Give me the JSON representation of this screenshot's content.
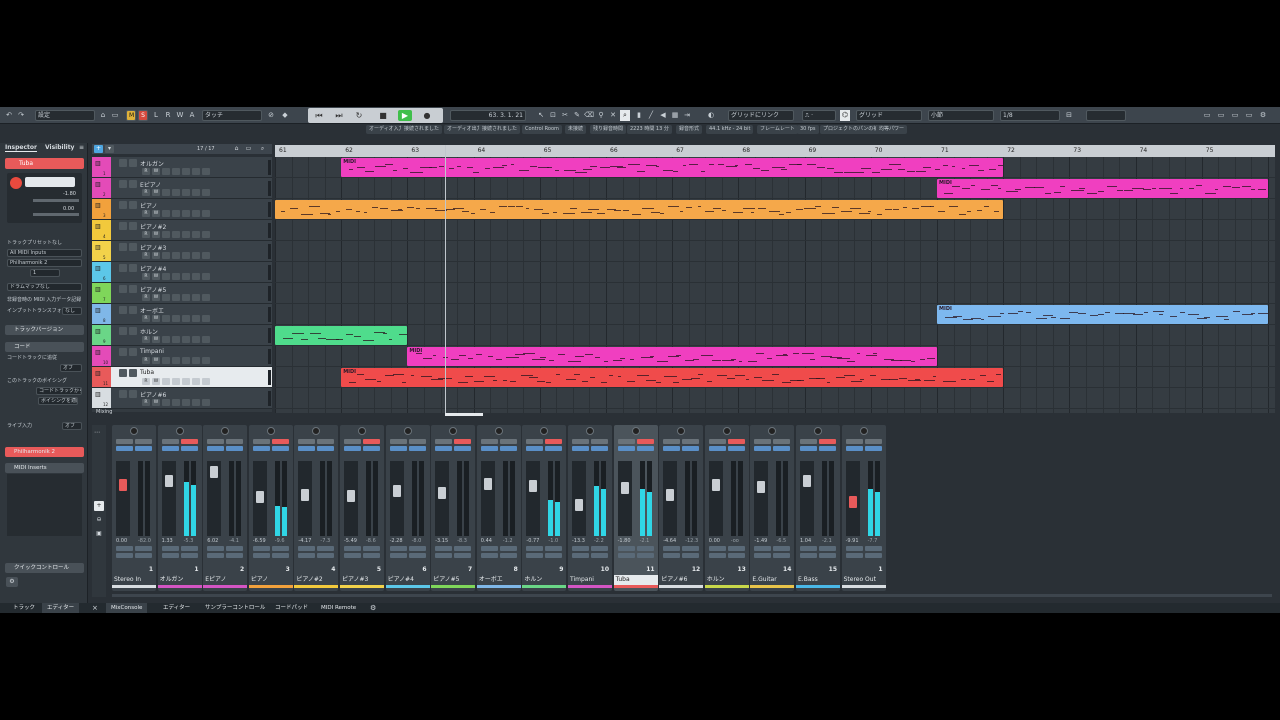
{
  "toolbar": {
    "preset": "設定",
    "mode_buttons": [
      "M",
      "S",
      "L",
      "R",
      "W",
      "A"
    ],
    "touch_mode": "タッチ",
    "position": "63. 3. 1. 21",
    "grid_link": "グリッドにリンク",
    "snap_type": "グリッド",
    "quantize_unit": "小節",
    "quantize_value": "1/8"
  },
  "status": [
    "オーディオ入力",
    "接続されました",
    "オーディオ出力",
    "接続されました",
    "Control Room",
    "未接続",
    "残り録音時間",
    "2223 時間 13 分",
    "録音形式",
    "44.1 kHz - 24 bit",
    "フレームレート",
    "30 fps",
    "プロジェクトのパンの補正",
    "均等パワー"
  ],
  "inspector": {
    "tabs": [
      "Inspector",
      "Visibility"
    ],
    "track_name": "Tuba",
    "volume": "-1.80",
    "value_zero": "0.00",
    "track_preset": "トラックプリセットなし",
    "midi_input": "All MIDI Inputs",
    "midi_output": "Philharmonik 2",
    "channel": "1",
    "drum_map": "ドラムマップなし",
    "mapping": "非録音時の MIDI 入力データ記録",
    "input_transformer": "インプットトランスフォーマー",
    "input_transformer_val": "なし",
    "sections": {
      "versions": "トラックバージョン",
      "chords": "コード",
      "chord_track": "コードトラックに追従",
      "chord_track_val": "オフ",
      "voicing": "このトラックのボイシング",
      "voicing_val": "コードトラックから",
      "voicing_adapt": "ボイシングを適応",
      "live_input": "ライブ入力",
      "live_input_val": "オフ",
      "instrument": "Philharmonik 2",
      "midi_inserts": "MIDI Inserts",
      "quick_controls": "クイックコントロール"
    }
  },
  "tracklist": {
    "count": "17 / 17",
    "footer": "Mixing",
    "buttons": [
      "R",
      "W",
      "",
      "",
      "",
      "",
      ""
    ],
    "tracks": [
      {
        "name": "オルガン",
        "num": "1",
        "color": "#e44bb8"
      },
      {
        "name": "Eピアノ",
        "num": "2",
        "color": "#e44bb8"
      },
      {
        "name": "ピアノ",
        "num": "3",
        "color": "#f2a13c"
      },
      {
        "name": "ピアノ#2",
        "num": "4",
        "color": "#f2c93c"
      },
      {
        "name": "ピアノ#3",
        "num": "5",
        "color": "#f2d24a"
      },
      {
        "name": "ピアノ#4",
        "num": "6",
        "color": "#5cc7e8"
      },
      {
        "name": "ピアノ#5",
        "num": "7",
        "color": "#7fd65a"
      },
      {
        "name": "オーボエ",
        "num": "8",
        "color": "#7fb7e8"
      },
      {
        "name": "ホルン",
        "num": "9",
        "color": "#6ad687"
      },
      {
        "name": "Timpani",
        "num": "10",
        "color": "#e44bb8"
      },
      {
        "name": "Tuba",
        "num": "11",
        "color": "#e85a5a"
      },
      {
        "name": "ピアノ#6",
        "num": "12",
        "color": "#d8dde1"
      }
    ]
  },
  "ruler": {
    "bars": [
      "61",
      "62",
      "63",
      "64",
      "65",
      "66",
      "67",
      "68",
      "69",
      "70",
      "71",
      "72",
      "73",
      "74",
      "75"
    ]
  },
  "arrange": {
    "clips": [
      {
        "lane": 0,
        "start": 62,
        "end": 72,
        "color": "#f03fc0",
        "label": "MIDI"
      },
      {
        "lane": 1,
        "start": 71,
        "end": 76,
        "color": "#f03fc0",
        "label": "MIDI"
      },
      {
        "lane": 2,
        "start": 61,
        "end": 72,
        "color": "#f5a84a",
        "label": ""
      },
      {
        "lane": 7,
        "start": 71,
        "end": 76,
        "color": "#7db8ef",
        "label": "MIDI"
      },
      {
        "lane": 8,
        "start": 61,
        "end": 63,
        "color": "#4fdc8c",
        "label": ""
      },
      {
        "lane": 9,
        "start": 63,
        "end": 71,
        "color": "#f03fc0",
        "label": "MIDI"
      },
      {
        "lane": 10,
        "start": 62,
        "end": 72,
        "color": "#f04b4b",
        "label": "MIDI"
      }
    ]
  },
  "mixer": {
    "channels": [
      {
        "name": "Stereo In",
        "num": "1",
        "vol": "0.00",
        "peak": "-82.0",
        "fader": 0.72,
        "level": 0.0,
        "color": "#d8dde1"
      },
      {
        "name": "オルガン",
        "num": "1",
        "vol": "1.33",
        "peak": "-5.3",
        "fader": 0.78,
        "level": 0.72,
        "color": "#d455c4"
      },
      {
        "name": "Eピアノ",
        "num": "2",
        "vol": "6.02",
        "peak": "-4.1",
        "fader": 0.92,
        "level": 0.0,
        "color": "#d455c4"
      },
      {
        "name": "ピアノ",
        "num": "3",
        "vol": "-6.59",
        "peak": "-9.6",
        "fader": 0.52,
        "level": 0.4,
        "color": "#f2a13c"
      },
      {
        "name": "ピアノ#2",
        "num": "4",
        "vol": "-4.17",
        "peak": "-7.3",
        "fader": 0.56,
        "level": 0.0,
        "color": "#f2c93c"
      },
      {
        "name": "ピアノ#3",
        "num": "5",
        "vol": "-5.49",
        "peak": "-8.6",
        "fader": 0.54,
        "level": 0.0,
        "color": "#f2d24a"
      },
      {
        "name": "ピアノ#4",
        "num": "6",
        "vol": "-2.28",
        "peak": "-8.0",
        "fader": 0.62,
        "level": 0.0,
        "color": "#5cc7e8"
      },
      {
        "name": "ピアノ#5",
        "num": "7",
        "vol": "-3.15",
        "peak": "-8.3",
        "fader": 0.58,
        "level": 0.0,
        "color": "#7fd65a"
      },
      {
        "name": "オーボエ",
        "num": "8",
        "vol": "0.44",
        "peak": "-1.2",
        "fader": 0.73,
        "level": 0.0,
        "color": "#7fb7e8"
      },
      {
        "name": "ホルン",
        "num": "9",
        "vol": "-0.77",
        "peak": "-1.0",
        "fader": 0.7,
        "level": 0.48,
        "color": "#6ad687"
      },
      {
        "name": "Timpani",
        "num": "10",
        "vol": "-13.3",
        "peak": "-2.2",
        "fader": 0.4,
        "level": 0.66,
        "color": "#d455c4"
      },
      {
        "name": "Tuba",
        "num": "11",
        "vol": "-1.80",
        "peak": "-2.1",
        "fader": 0.66,
        "level": 0.62,
        "color": "#e85a5a"
      },
      {
        "name": "ピアノ#6",
        "num": "12",
        "vol": "-4.64",
        "peak": "-12.3",
        "fader": 0.56,
        "level": 0.0,
        "color": "#d8dde1"
      },
      {
        "name": "ホルン",
        "num": "13",
        "vol": "0.00",
        "peak": "-oo",
        "fader": 0.72,
        "level": 0.0,
        "color": "#c8d84a"
      },
      {
        "name": "E.Guitar",
        "num": "14",
        "vol": "-1.49",
        "peak": "-6.5",
        "fader": 0.68,
        "level": 0.0,
        "color": "#e8c44a"
      },
      {
        "name": "E.Bass",
        "num": "15",
        "vol": "1.04",
        "peak": "-2.1",
        "fader": 0.77,
        "level": 0.0,
        "color": "#4ab8e8"
      },
      {
        "name": "Stereo Out",
        "num": "1",
        "vol": "-9.91",
        "peak": "-7.7",
        "fader": 0.44,
        "level": 0.62,
        "color": "#d8dde1"
      }
    ]
  },
  "tabs": [
    "トラック",
    "エディター",
    "MixConsole",
    "エディター",
    "サンプラーコントロール",
    "コードパッド",
    "MIDI Remote"
  ]
}
